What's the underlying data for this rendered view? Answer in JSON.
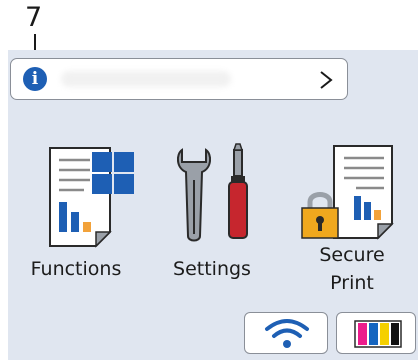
{
  "callout": {
    "number": "7"
  },
  "info_bar": {
    "icon": "info-icon",
    "chevron": "chevron-right-icon"
  },
  "tiles": [
    {
      "label": "Functions",
      "icon": "functions-icon"
    },
    {
      "label": "Settings",
      "icon": "settings-icon"
    },
    {
      "label_line1": "Secure",
      "label_line2": "Print",
      "icon": "secure-print-icon"
    }
  ],
  "status": {
    "wifi_icon": "wifi-icon",
    "ink_icon": "ink-levels-icon"
  },
  "colors": {
    "screen_bg": "#e0e6f0",
    "accent_blue": "#1e5fb4",
    "red": "#c6262e",
    "orange": "#f2a23a",
    "gold": "#f0a81e"
  }
}
